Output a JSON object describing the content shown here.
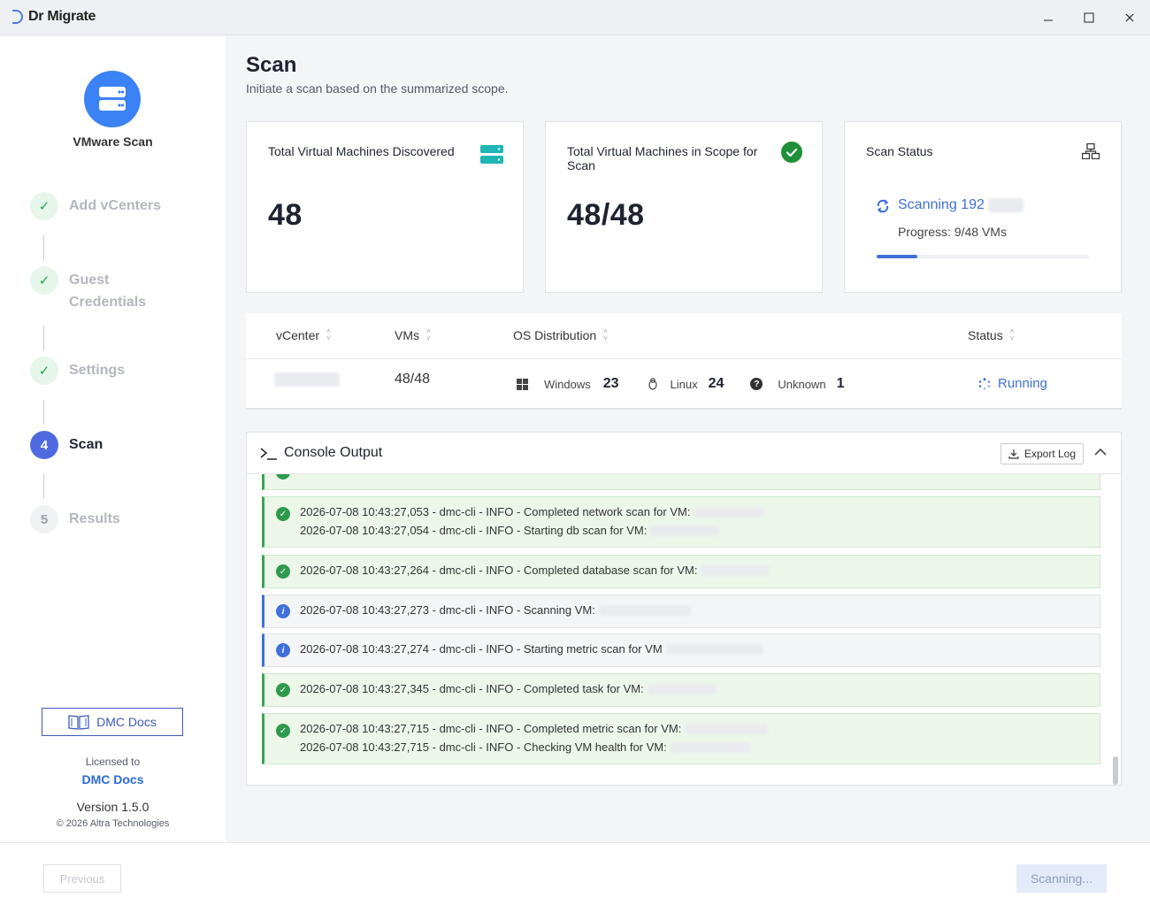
{
  "window": {
    "title": "Dr Migrate"
  },
  "sidebar": {
    "hero_title": "VMware Scan",
    "steps": [
      {
        "label": "Add vCenters",
        "state": "done"
      },
      {
        "label": "Guest",
        "label2": "Credentials",
        "state": "done"
      },
      {
        "label": "Settings",
        "state": "done"
      },
      {
        "number": "4",
        "label": "Scan",
        "state": "active"
      },
      {
        "number": "5",
        "label": "Results",
        "state": "pending"
      }
    ],
    "docs_button": "DMC Docs",
    "licensed_to_label": "Licensed to",
    "licensee": "DMC Docs",
    "version": "Version 1.5.0",
    "copyright": "© 2026 Altra Technologies"
  },
  "main": {
    "title": "Scan",
    "subtitle": "Initiate a scan based on the summarized scope.",
    "cards": {
      "discovered": {
        "title": "Total Virtual Machines Discovered",
        "value": "48"
      },
      "in_scope": {
        "title": "Total Virtual Machines in Scope for Scan",
        "value": "48/48"
      },
      "status": {
        "title": "Scan Status",
        "scanning": "Scanning 192",
        "progress_text": "Progress: 9/48 VMs",
        "progress_fraction": 0.19
      }
    },
    "table": {
      "headers": {
        "vcenter": "vCenter",
        "vms": "VMs",
        "os": "OS Distribution",
        "status": "Status"
      },
      "row": {
        "vms": "48/48",
        "windows_label": "Windows",
        "windows_count": "23",
        "linux_label": "Linux",
        "linux_count": "24",
        "unknown_label": "Unknown",
        "unknown_count": "1",
        "status": "Running"
      }
    },
    "console": {
      "title": "Console Output",
      "export_label": "Export Log",
      "entries": [
        {
          "type": "success",
          "lines": [
            "2026-07-08 10:43:27,053 - dmc-cli - INFO - Completed network scan for VM:",
            "2026-07-08 10:43:27,054 - dmc-cli - INFO - Starting db scan for VM:"
          ]
        },
        {
          "type": "success",
          "lines": [
            "2026-07-08 10:43:27,264 - dmc-cli - INFO - Completed database scan for VM:"
          ]
        },
        {
          "type": "info",
          "lines": [
            "2026-07-08 10:43:27,273 - dmc-cli - INFO - Scanning VM:"
          ]
        },
        {
          "type": "info",
          "lines": [
            "2026-07-08 10:43:27,274 - dmc-cli - INFO - Starting metric scan for VM"
          ]
        },
        {
          "type": "success",
          "lines": [
            "2026-07-08 10:43:27,345 - dmc-cli - INFO - Completed task for VM:"
          ]
        },
        {
          "type": "success",
          "lines": [
            "2026-07-08 10:43:27,715 - dmc-cli - INFO - Completed metric scan for VM:",
            "2026-07-08 10:43:27,715 - dmc-cli - INFO - Checking VM health for VM:"
          ]
        }
      ]
    }
  },
  "footer": {
    "previous_label": "Previous",
    "scanning_label": "Scanning..."
  },
  "colors": {
    "accent": "#3b82f6",
    "success": "#22a34a",
    "brand": "#3f5ab8"
  }
}
